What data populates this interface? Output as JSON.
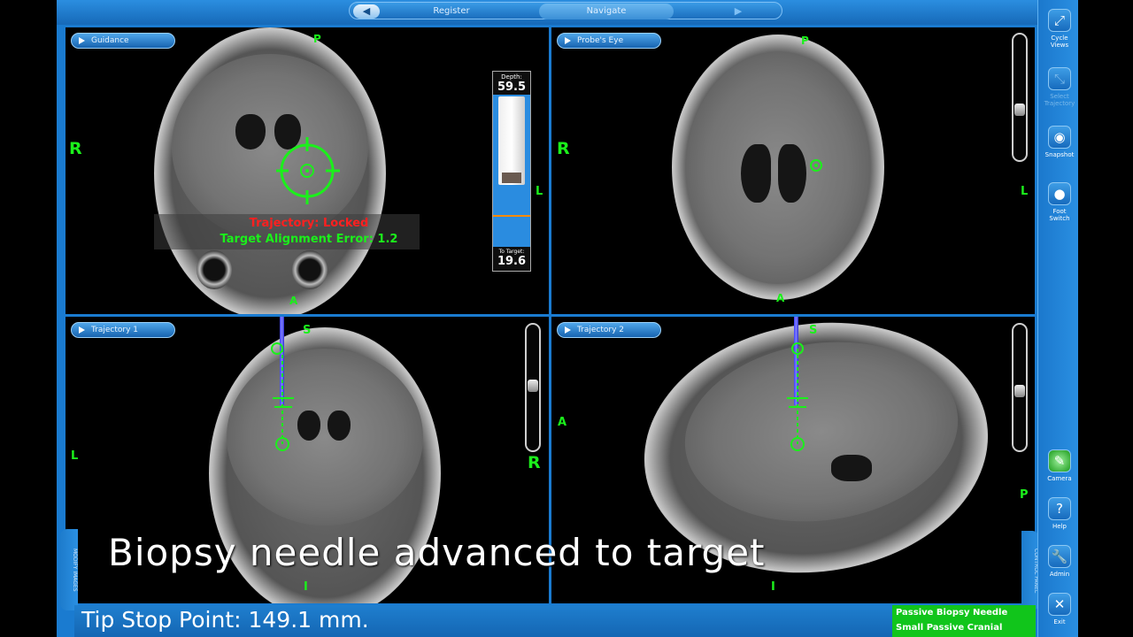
{
  "nav": {
    "back_icon": "left-arrow-icon",
    "tabs": [
      "Register",
      "Navigate"
    ],
    "active_tab": "Navigate",
    "forward_icon": "right-arrow-icon"
  },
  "views": {
    "guidance": {
      "label": "Guidance",
      "orient": {
        "top": "P",
        "left": "R",
        "right": "L",
        "bottom": "A"
      },
      "status_locked": "Trajectory: Locked",
      "status_error": "Target Alignment Error: 1.2",
      "depth_label": "Depth:",
      "depth_value": "59.5",
      "to_target_label": "To Target:",
      "to_target_value": "19.6"
    },
    "probes_eye": {
      "label": "Probe's Eye",
      "orient": {
        "top": "P",
        "left": "R",
        "right": "L",
        "bottom": "A"
      }
    },
    "trajectory1": {
      "label": "Trajectory 1",
      "orient": {
        "top": "S",
        "left": "L",
        "right": "R",
        "bottom": "I"
      }
    },
    "trajectory2": {
      "label": "Trajectory 2",
      "orient": {
        "top": "S",
        "left": "A",
        "right": "P",
        "bottom": "I"
      }
    }
  },
  "sidebar": [
    {
      "label": "Cycle Views",
      "icon": "cycle-views-icon",
      "enabled": true
    },
    {
      "label": "Select Trajectory",
      "icon": "select-trajectory-icon",
      "enabled": false
    },
    {
      "label": "Snapshot",
      "icon": "camera-snapshot-icon",
      "enabled": true
    },
    {
      "label": "Foot Switch",
      "icon": "microphone-icon",
      "enabled": true
    },
    {
      "label": "Camera",
      "icon": "camera-tracking-icon",
      "enabled": true
    },
    {
      "label": "Help",
      "icon": "help-icon",
      "enabled": true
    },
    {
      "label": "Admin",
      "icon": "wrench-icon",
      "enabled": true
    },
    {
      "label": "Exit",
      "icon": "close-icon",
      "enabled": true
    }
  ],
  "side_tabs": {
    "left": "MODIFY IMAGES",
    "right": "CONTROL PANEL"
  },
  "status": {
    "tip_stop": "Tip Stop Point: 149.1 mm."
  },
  "equipment": [
    "Passive Biopsy Needle",
    "Small Passive Cranial Frame"
  ],
  "caption": "Biopsy needle advanced to target",
  "colors": {
    "accent": "#1a7bd0",
    "overlay_green": "#1bf01b",
    "locked_red": "#ff2020",
    "equipment_bg": "#11c51b"
  }
}
